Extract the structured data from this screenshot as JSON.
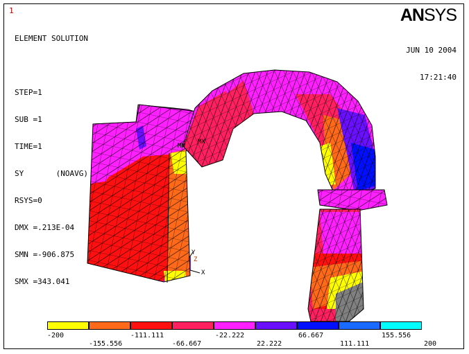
{
  "window_number": "1",
  "logo": {
    "bold": "AN",
    "thin": "SYS"
  },
  "info": [
    "ELEMENT SOLUTION",
    "",
    "STEP=1",
    "SUB =1",
    "TIME=1",
    "SY       (NOAVG)",
    "RSYS=0",
    "DMX =.213E-04",
    "SMN =-906.875",
    "SMX =343.041"
  ],
  "date": "JUN 10 2004",
  "time": "17:21:40",
  "markers": {
    "mn": "MN",
    "mx": "MX",
    "axis_x": "X",
    "axis_y": "Y",
    "axis_z": "Z"
  },
  "colors": {
    "yellow": "#ffff00",
    "orange": "#ff6a1a",
    "red": "#ff1010",
    "crimson": "#ff2060",
    "magenta": "#ff20ff",
    "violet": "#6a10ff",
    "blue": "#0010ff",
    "azure": "#1a6aff",
    "cyan": "#00ffff",
    "gray": "#808080"
  },
  "legend": {
    "swatch_colors": [
      "#ffff00",
      "#ff6a1a",
      "#ff1010",
      "#ff2060",
      "#ff20ff",
      "#6a10ff",
      "#0010ff",
      "#1a6aff",
      "#00ffff"
    ],
    "labels": [
      "-200",
      "-155.556",
      "-111.111",
      "-66.667",
      "-22.222",
      "22.222",
      "66.667",
      "111.111",
      "155.556",
      "200"
    ]
  }
}
